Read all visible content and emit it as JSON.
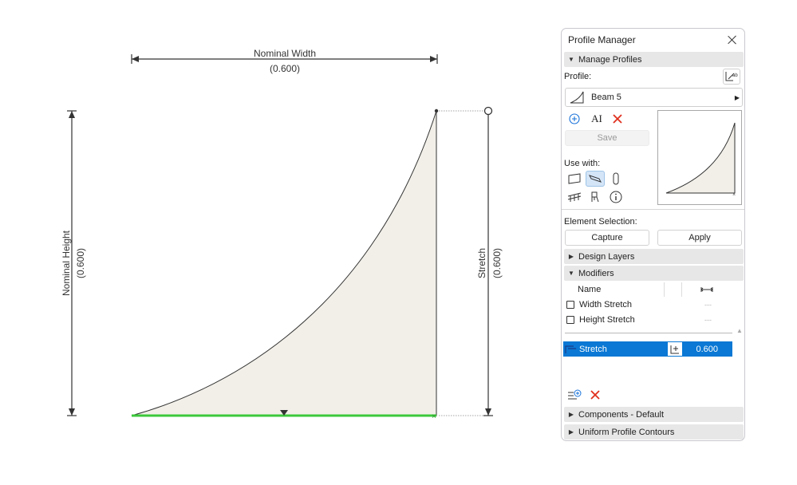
{
  "drawing": {
    "nominal_width_label": "Nominal Width",
    "nominal_width_value": "(0.600)",
    "nominal_height_label": "Nominal Height",
    "nominal_height_value": "(0.600)",
    "stretch_label": "Stretch",
    "stretch_value": "(0.600)",
    "colors": {
      "fill": "#f1efe8",
      "outline": "#333333",
      "base_edge": "#3cc83c",
      "dimension": "#333333"
    }
  },
  "panel": {
    "title": "Profile Manager",
    "manage_profiles": "Manage Profiles",
    "profile_label": "Profile:",
    "profile_name": "Beam 5",
    "save_label": "Save",
    "use_with_label": "Use with:",
    "element_selection_label": "Element Selection:",
    "capture_label": "Capture",
    "apply_label": "Apply",
    "design_layers": "Design Layers",
    "modifiers": "Modifiers",
    "modifiers_table": {
      "name_header": "Name",
      "rows": [
        {
          "name": "Width Stretch",
          "value": "---"
        },
        {
          "name": "Height Stretch",
          "value": "---"
        }
      ],
      "selected": {
        "name": "Stretch",
        "value": "0.600"
      }
    },
    "components_default": "Components - Default",
    "uniform_profile_contours": "Uniform Profile Contours",
    "colors": {
      "selection": "#0a78d4",
      "section_bg": "#e7e7e8",
      "delete": "#e0301e",
      "add": "#1a73d9"
    }
  }
}
